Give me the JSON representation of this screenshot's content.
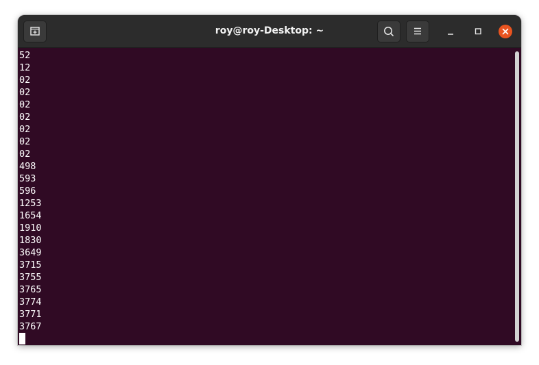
{
  "window": {
    "title": "roy@roy-Desktop: ~"
  },
  "icons": {
    "new_tab": "new-tab-icon",
    "search": "search-icon",
    "menu": "hamburger-menu-icon",
    "minimize": "minimize-icon",
    "maximize": "maximize-icon",
    "close": "close-icon"
  },
  "colors": {
    "terminal_background": "#300a24",
    "titlebar": "#2c2c2c",
    "close_button": "#e95420",
    "text": "#ffffff"
  },
  "terminal": {
    "lines": [
      "52",
      "12",
      "02",
      "02",
      "02",
      "02",
      "02",
      "02",
      "02",
      "498",
      "593",
      "596",
      "1253",
      "1654",
      "1910",
      "1830",
      "3649",
      "3715",
      "3755",
      "3765",
      "3774",
      "3771",
      "3767"
    ]
  }
}
